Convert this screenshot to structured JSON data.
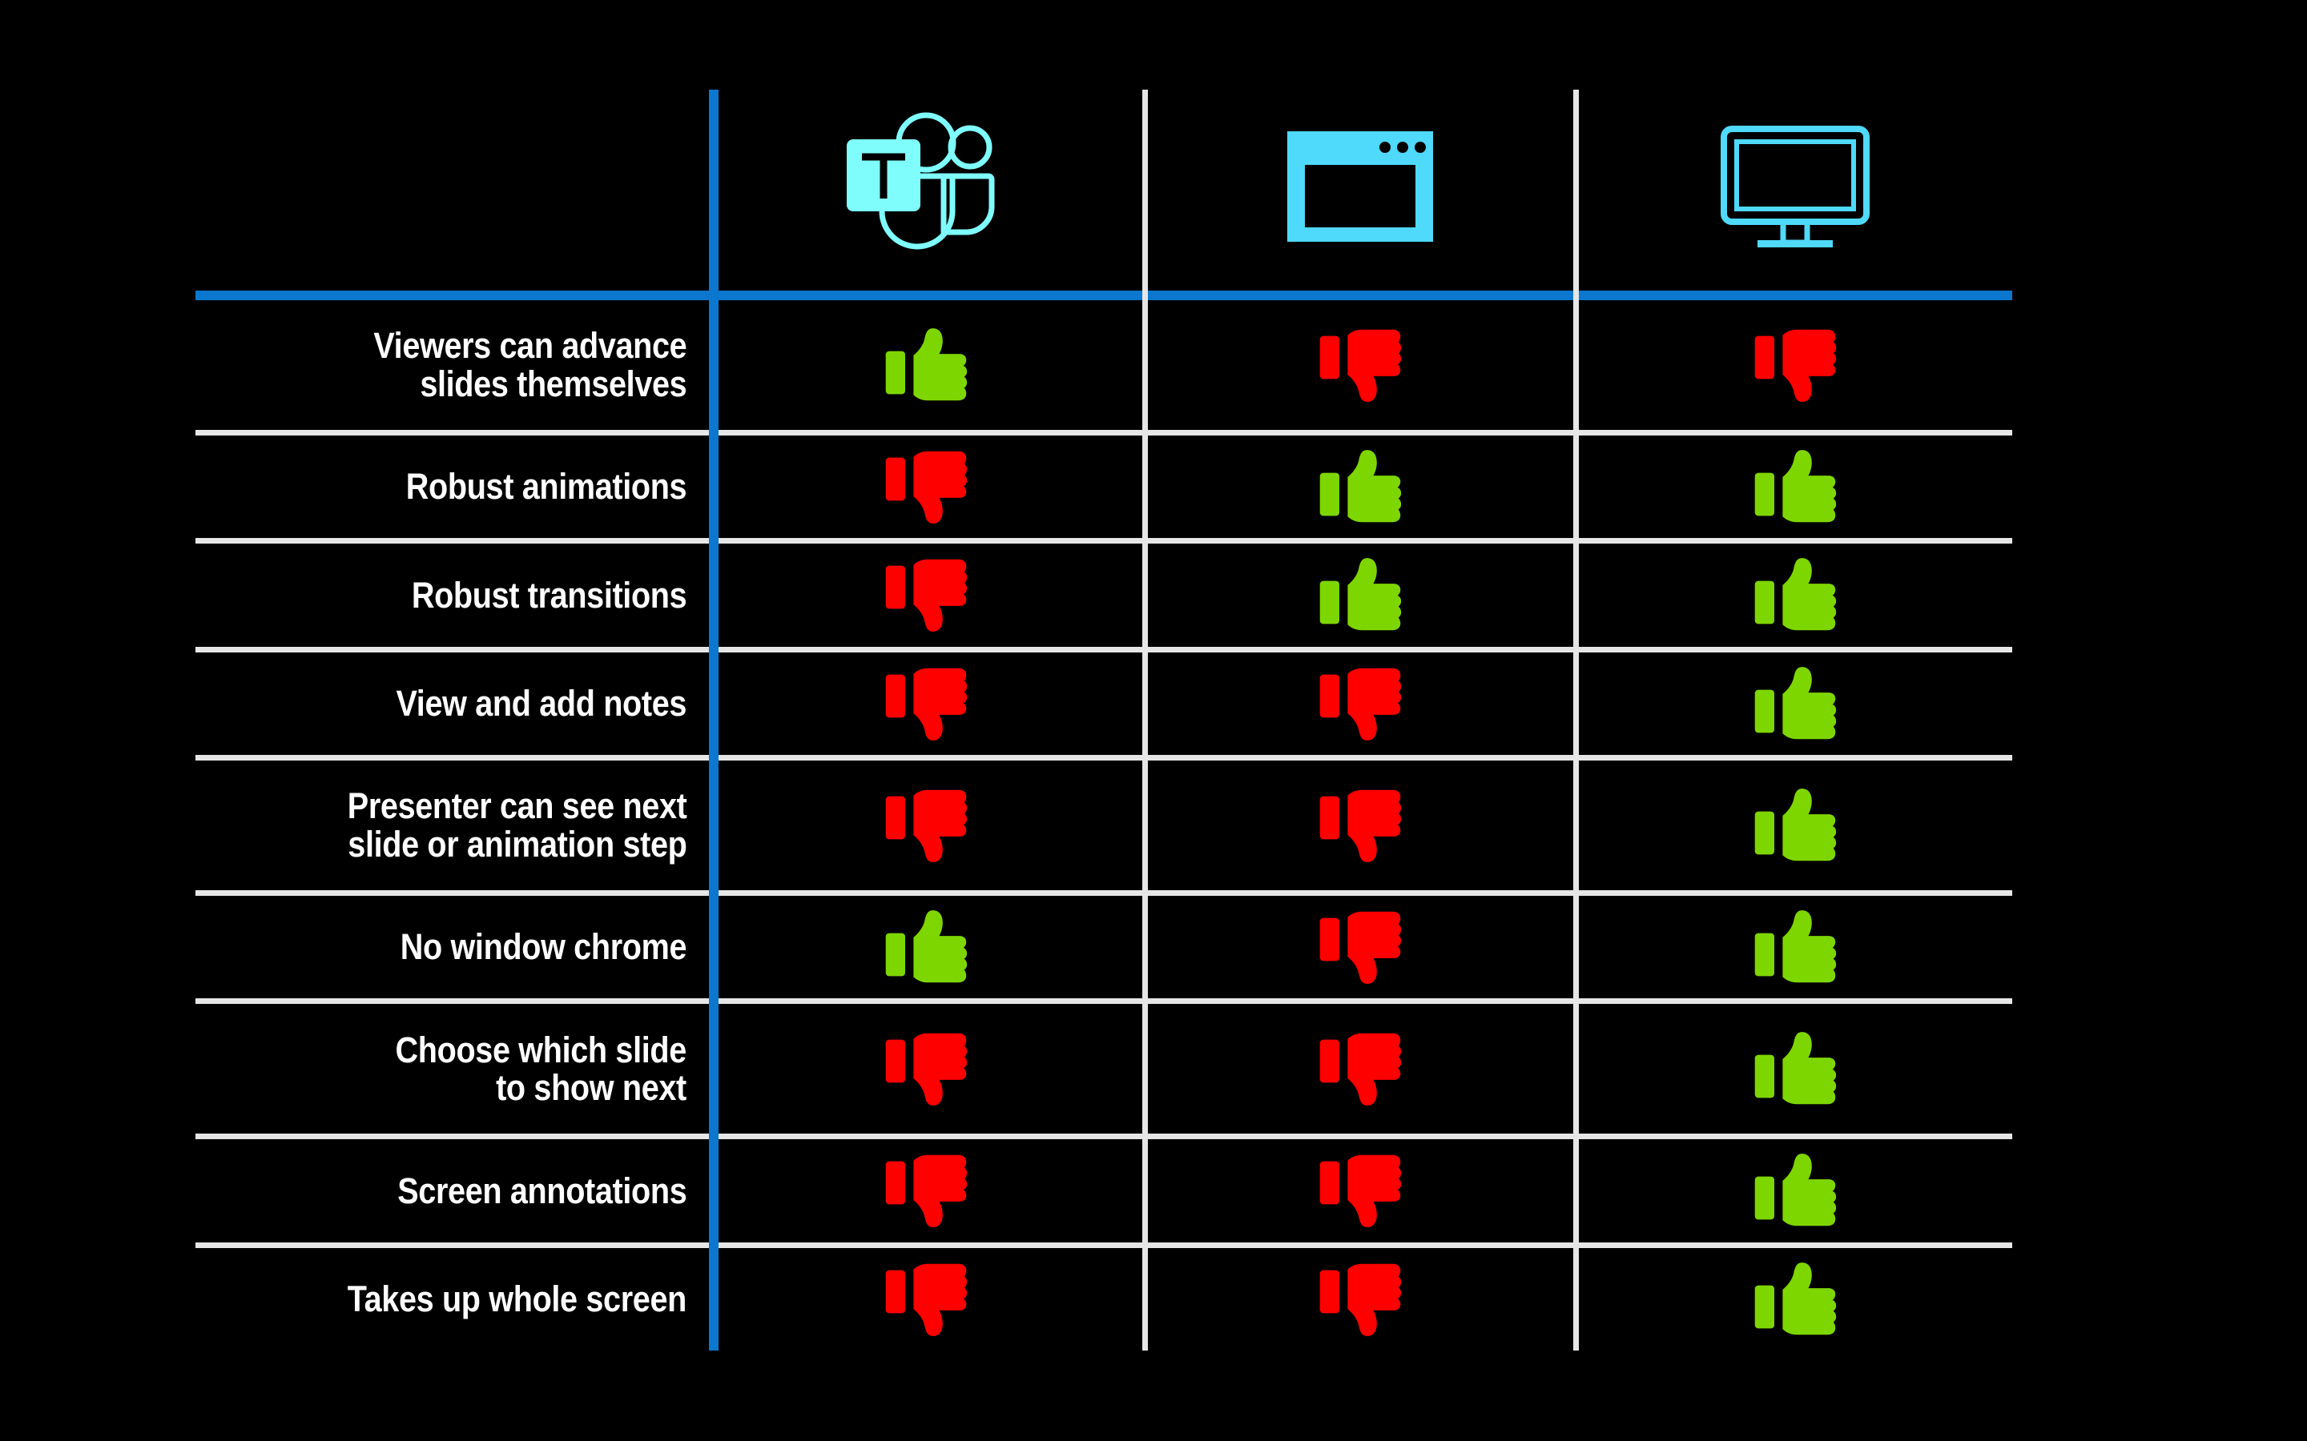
{
  "slide": {
    "background_color": "#000000",
    "accent_blue": "#0b77ce",
    "separator_color": "#e6e6e6",
    "icon_cyan": "#7ffcfc",
    "yes_color": "#7ed600",
    "no_color": "#fe0000",
    "text_color": "#ffffff"
  },
  "table": {
    "columns": [
      {
        "id": "feature",
        "label": "",
        "icon": ""
      },
      {
        "id": "teams",
        "label": "",
        "icon": "microsoft-teams-icon"
      },
      {
        "id": "window",
        "label": "",
        "icon": "application-window-icon"
      },
      {
        "id": "monitor",
        "label": "",
        "icon": "desktop-monitor-icon"
      }
    ],
    "rows": [
      {
        "label": "Viewers can advance\nslides themselves",
        "values": [
          "yes",
          "no",
          "no"
        ]
      },
      {
        "label": "Robust animations",
        "values": [
          "no",
          "yes",
          "yes"
        ]
      },
      {
        "label": "Robust transitions",
        "values": [
          "no",
          "yes",
          "yes"
        ]
      },
      {
        "label": "View and add notes",
        "values": [
          "no",
          "no",
          "yes"
        ]
      },
      {
        "label": "Presenter can see next\nslide or animation step",
        "values": [
          "no",
          "no",
          "yes"
        ]
      },
      {
        "label": "No window chrome",
        "values": [
          "yes",
          "no",
          "yes"
        ]
      },
      {
        "label": "Choose which slide\nto show next",
        "values": [
          "no",
          "no",
          "yes"
        ]
      },
      {
        "label": "Screen annotations",
        "values": [
          "no",
          "no",
          "yes"
        ]
      },
      {
        "label": "Takes up whole screen",
        "values": [
          "no",
          "no",
          "yes"
        ]
      }
    ],
    "legend": {
      "yes": "thumbs-up-icon",
      "no": "thumbs-down-icon"
    }
  }
}
